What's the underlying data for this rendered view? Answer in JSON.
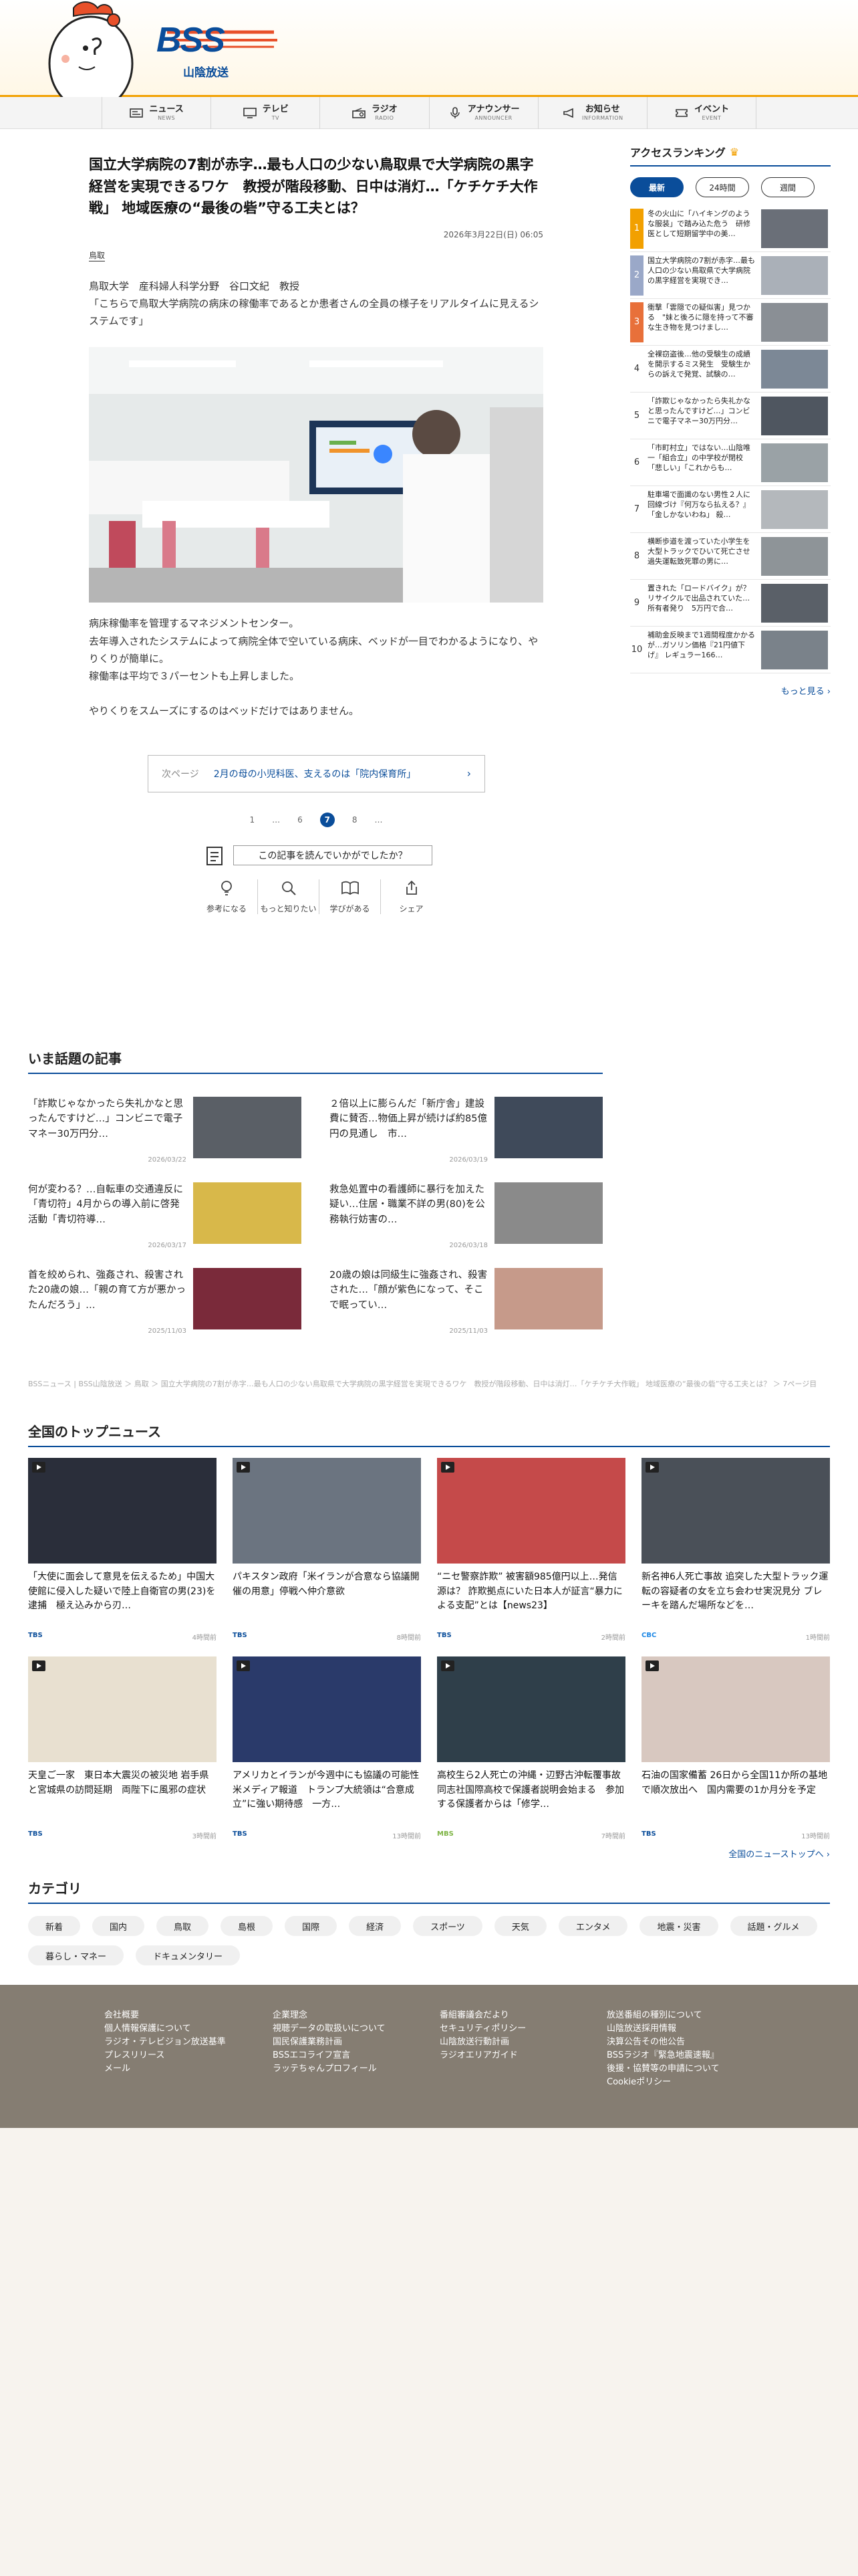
{
  "brand": {
    "logo_text": "BSS",
    "station_name": "山陰放送",
    "brand_color": "#0a4d9a",
    "accent_color": "#f2a000"
  },
  "nav": [
    {
      "jp": "ニュース",
      "en": "NEWS",
      "icon": "news-icon"
    },
    {
      "jp": "テレビ",
      "en": "TV",
      "icon": "tv-icon"
    },
    {
      "jp": "ラジオ",
      "en": "RADIO",
      "icon": "radio-icon"
    },
    {
      "jp": "アナウンサー",
      "en": "ANNOUNCER",
      "icon": "microphone-icon"
    },
    {
      "jp": "お知らせ",
      "en": "INFORMATION",
      "icon": "megaphone-icon"
    },
    {
      "jp": "イベント",
      "en": "EVENT",
      "icon": "ticket-icon"
    }
  ],
  "article": {
    "title": "国立大学病院の7割が赤字…最も人口の少ない鳥取県で大学病院の黒字経営を実現できるワケ　教授が階段移動、日中は消灯…「ケチケチ大作戦」 地域医療の“最後の砦”守る工夫とは？",
    "date": "2026年3月22日(日) 06:05",
    "tag": "鳥取",
    "p1": "鳥取大学　産科婦人科学分野　谷口文紀　教授",
    "p2": "「こちらで鳥取大学病院の病床の稼働率であるとか患者さんの全員の様子をリアルタイムに見えるシステムです」",
    "p3": "病床稼働率を管理するマネジメントセンター。",
    "p4": "去年導入されたシステムによって病院全体で空いている病床、ベッドが一目でわかるようになり、やりくりが簡単に。",
    "p5": "稼働率は平均で３パーセントも上昇しました。",
    "p6": "やりくりをスムーズにするのはベッドだけではありません。",
    "next_label": "次ページ",
    "next_title": "2月の母の小児科医、支えるのは「院内保育所」",
    "pages": [
      "1",
      "…",
      "6",
      "7",
      "8",
      "…"
    ],
    "current_page": "7",
    "survey_q": "この記事を読んでいかがでしたか？",
    "reactions": [
      {
        "label": "参考になる",
        "icon": "lightbulb-icon"
      },
      {
        "label": "もっと知りたい",
        "icon": "magnifier-icon"
      },
      {
        "label": "学びがある",
        "icon": "book-icon"
      },
      {
        "label": "シェア",
        "icon": "share-icon"
      }
    ]
  },
  "ranking": {
    "title": "アクセスランキング",
    "tabs": [
      "最新",
      "24時間",
      "週間"
    ],
    "active_tab": "最新",
    "items": [
      {
        "no": "1",
        "text": "冬の火山に「ハイキングのような服装」で踏み込た危う　研修医として短期留学中の美…"
      },
      {
        "no": "2",
        "text": "国立大学病院の7割が赤字…最も人口の少ない鳥取県で大学病院の黒字経営を実現でき…"
      },
      {
        "no": "3",
        "text": "衝撃「雲隠での疑似害」見つかる　\"妹と後ろに隠を持って不審な生き物を見つけまし…"
      },
      {
        "no": "4",
        "text": "全裸窃盗後…他の受験生の成績を開示するミス発生　受験生からの訴えで発覚、試験の…"
      },
      {
        "no": "5",
        "text": "「詐欺じゃなかったら失礼かなと思ったんですけど…」コンビニで電子マネー30万円分…"
      },
      {
        "no": "6",
        "text": "「市町村立」ではない…山陰唯一「組合立」の中学校が閉校「悲しい」「これからも…"
      },
      {
        "no": "7",
        "text": "駐車場で面識のない男性２人に回線づけ『何万なら払える？』「金しかないわね」 殺…"
      },
      {
        "no": "8",
        "text": "横断歩道を渡っていた小学生を大型トラックでひいて死亡させ過失運転致死罪の男に…"
      },
      {
        "no": "9",
        "text": "置きれた「ロードバイク」が？リサイクルで出品されていた…所有者発り　5万円で合…"
      },
      {
        "no": "10",
        "text": "補助金反映まで1週間程度かかるが…ガソリン価格『21円値下げ』 レギュラー166…"
      }
    ],
    "more": "もっと見る"
  },
  "trending": {
    "title": "いま話題の記事",
    "items": [
      {
        "text": "「詐欺じゃなかったら失礼かなと思ったんですけど…」コンビニで電子マネー30万円分…",
        "date": "2026/03/22"
      },
      {
        "text": "２倍以上に膨らんだ「新庁舎」建設費に賛否…物価上昇が続けば約85億円の見通し　市…",
        "date": "2026/03/19"
      },
      {
        "text": "何が変わる？…自転車の交通違反に「青切符」4月からの導入前に啓発活動「青切符導…",
        "date": "2026/03/17"
      },
      {
        "text": "救急処置中の看護師に暴行を加えた疑い…住居・職業不詳の男(80)を公務執行妨害の…",
        "date": "2026/03/18"
      },
      {
        "text": "首を絞められ、強姦され、殺害された20歳の娘…「親の育て方が悪かったんだろう」…",
        "date": "2025/11/03"
      },
      {
        "text": "20歳の娘は同級生に強姦され、殺害された…「顔が紫色になって、そこで眠ってい…",
        "date": "2025/11/03"
      }
    ]
  },
  "breadcrumb": "BSSニュース | BSS山陰放送 ＞ 鳥取 ＞ 国立大学病院の7割が赤字…最も人口の少ない鳥取県で大学病院の黒字経営を実現できるワケ　教授が階段移動、日中は消灯…「ケチケチ大作戦」 地域医療の“最後の砦”守る工夫とは？ ＞ 7ページ目",
  "topnews": {
    "title": "全国のトップニュース",
    "items": [
      {
        "text": "「大使に面会して意見を伝えるため」中国大使館に侵入した疑いで陸上自衛官の男(23)を逮捕　極え込みから刃…",
        "src": "TBS",
        "time": "4時間前"
      },
      {
        "text": "パキスタン政府「米イランが合意なら協議開催の用意」停戦へ仲介意欲",
        "src": "TBS",
        "time": "8時間前"
      },
      {
        "text": "“ニセ警察詐欺” 被害額985億円以上…発信源は？ 詐欺拠点にいた日本人が証言“暴力による支配”とは【news23】",
        "src": "TBS",
        "time": "2時間前"
      },
      {
        "text": "新名神6人死亡事故 追突した大型トラック運転の容疑者の女を立ち会わせ実況見分 ブレーキを踏んだ場所などを…",
        "src": "CBC",
        "time": "1時間前"
      },
      {
        "text": "天皇ご一家　東日本大震災の被災地 岩手県と宮城県の訪問延期　両陛下に風邪の症状",
        "src": "TBS",
        "time": "3時間前"
      },
      {
        "text": "アメリカとイランが今週中にも協議の可能性 米メディア報道　トランプ大統領は“合意成立”に強い期待感　一方…",
        "src": "TBS",
        "time": "13時間前"
      },
      {
        "text": "高校生ら2人死亡の沖縄・辺野古沖転覆事故　同志社国際高校で保護者説明会始まる　参加する保護者からは「修学…",
        "src": "MBS",
        "time": "7時間前"
      },
      {
        "text": "石油の国家備蓄 26日から全国11か所の基地で順次放出へ　国内需要の1か月分を予定",
        "src": "TBS",
        "time": "13時間前"
      }
    ],
    "more": "全国のニューストップへ"
  },
  "categories": {
    "title": "カテゴリ",
    "items": [
      "新着",
      "国内",
      "鳥取",
      "島根",
      "国際",
      "経済",
      "スポーツ",
      "天気",
      "エンタメ",
      "地震・災害",
      "話題・グルメ",
      "暮らし・マネー",
      "ドキュメンタリー"
    ]
  },
  "footer": {
    "cols": [
      [
        "会社概要",
        "個人情報保護について",
        "ラジオ・テレビジョン放送基準",
        "プレスリリース",
        "メール"
      ],
      [
        "企業理念",
        "視聴データの取扱いについて",
        "国民保護業務計画",
        "BSSエコライフ宣言",
        "ラッテちゃんプロフィール"
      ],
      [
        "番組審議会だより",
        "セキュリティポリシー",
        "山陰放送行動計画",
        "ラジオエリアガイド"
      ],
      [
        "放送番組の種別について",
        "山陰放送採用情報",
        "決算公告その他公告",
        "BSSラジオ『緊急地震速報』",
        "後援・協賛等の申請について",
        "Cookieポリシー"
      ]
    ]
  }
}
